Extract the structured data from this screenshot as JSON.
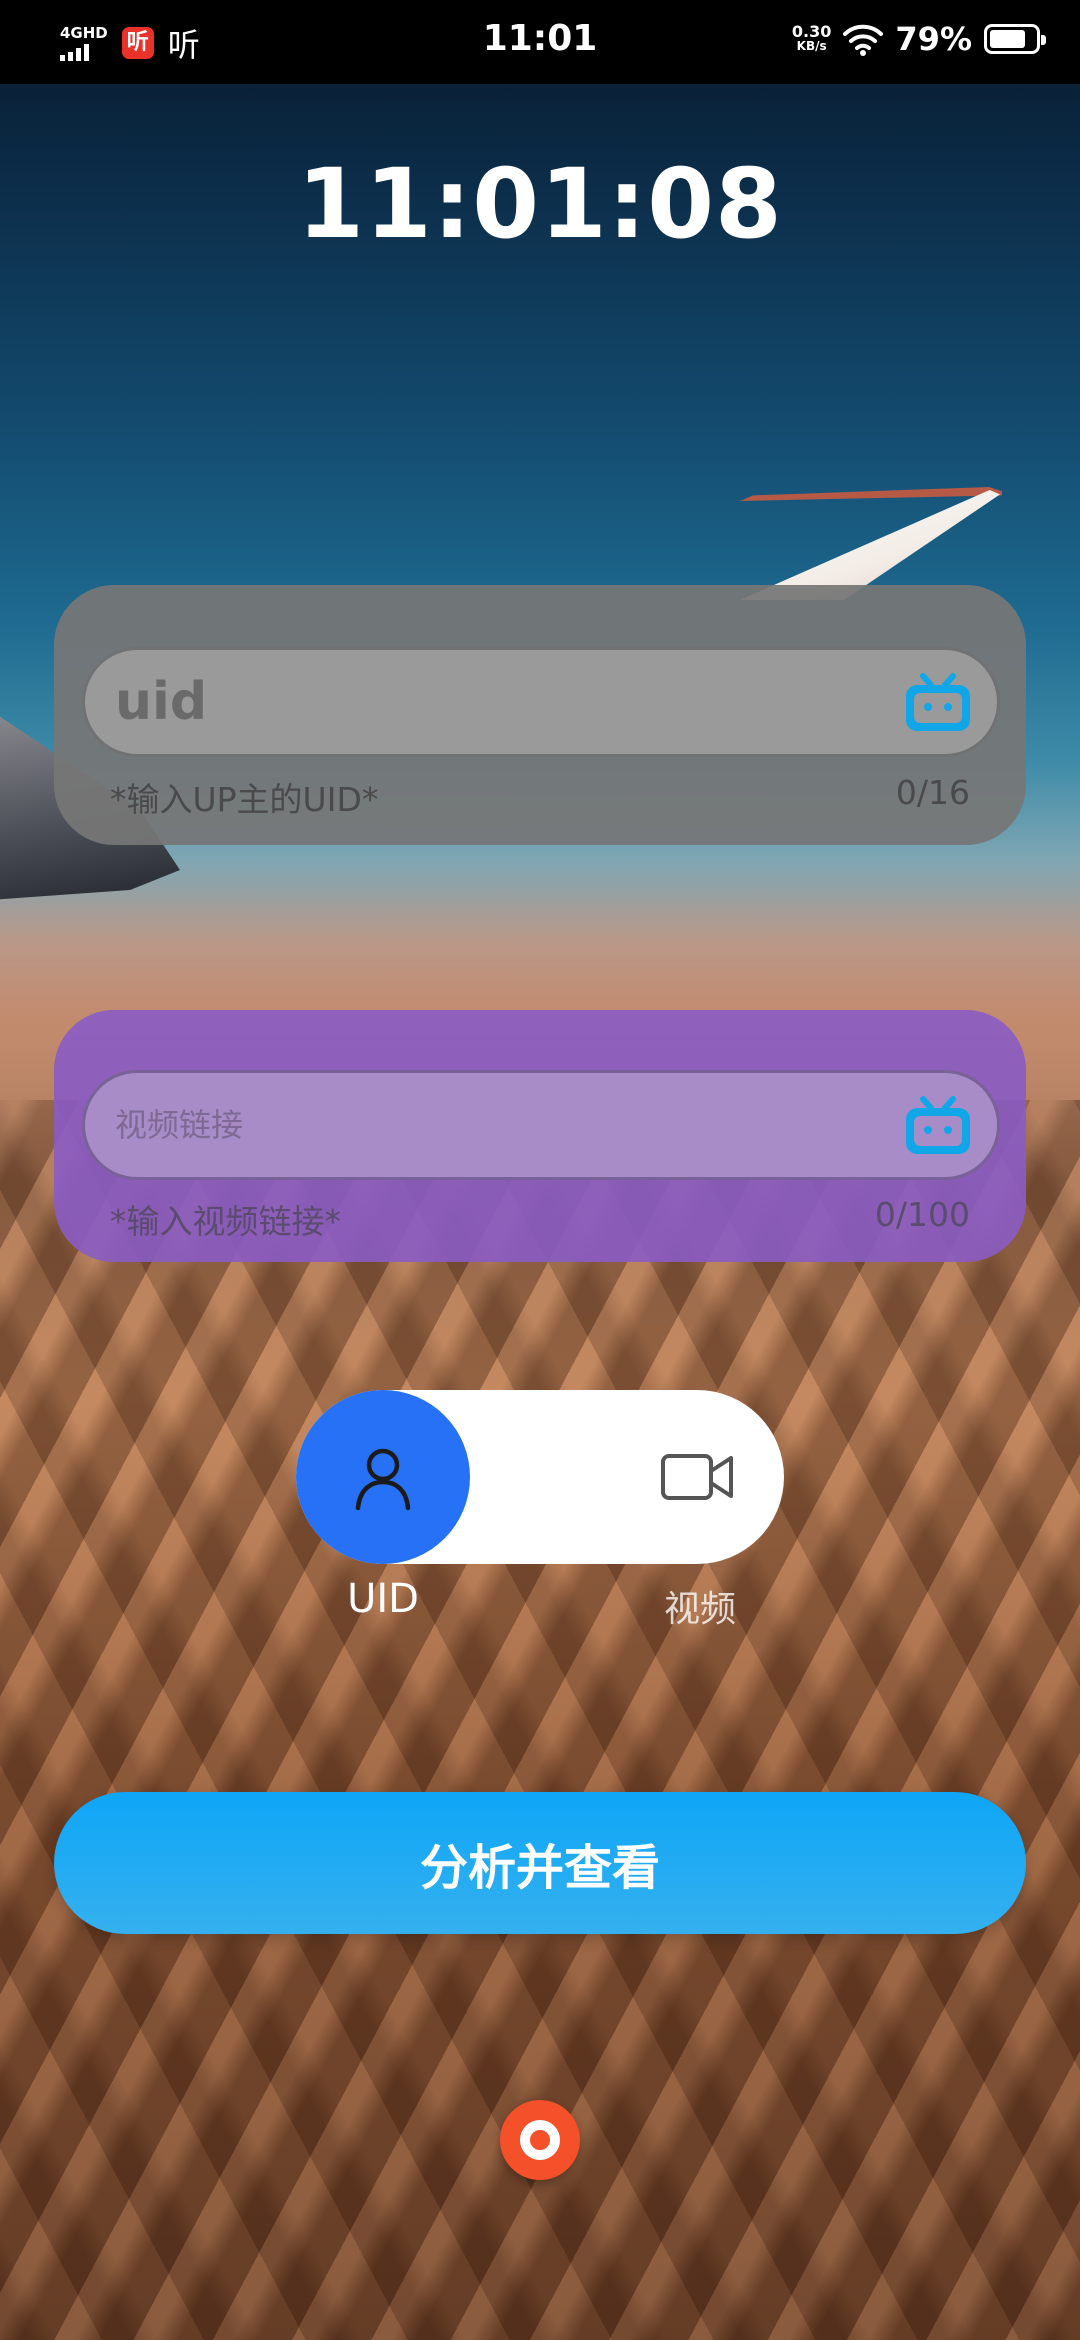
{
  "status_bar": {
    "network_type": "4GHD",
    "app_badge": "听",
    "app_label": "听",
    "time": "11:01",
    "net_speed_value": "0.30",
    "net_speed_unit": "KB/s",
    "battery_percent": "79%",
    "battery_level": 0.79
  },
  "clock": {
    "time": "11:01:08"
  },
  "uid_card": {
    "placeholder": "uid",
    "value": "",
    "hint": "*输入UP主的UID*",
    "counter": "0/16",
    "icon": "bilibili-tv-icon",
    "background": "#767676"
  },
  "video_card": {
    "placeholder": "视频链接",
    "value": "",
    "hint": "*输入视频链接*",
    "counter": "0/100",
    "icon": "bilibili-tv-icon",
    "background": "#895cc4"
  },
  "mode_switch": {
    "selected": "UID",
    "options": [
      {
        "label": "UID",
        "icon": "user-icon"
      },
      {
        "label": "视频",
        "icon": "video-camera-icon"
      }
    ],
    "knob_color": "#2671f5"
  },
  "analyze_button": {
    "label": "分析并查看",
    "color": "#0ea6f7"
  },
  "float_button": {
    "icon": "record-icon",
    "color": "#f4502a"
  }
}
